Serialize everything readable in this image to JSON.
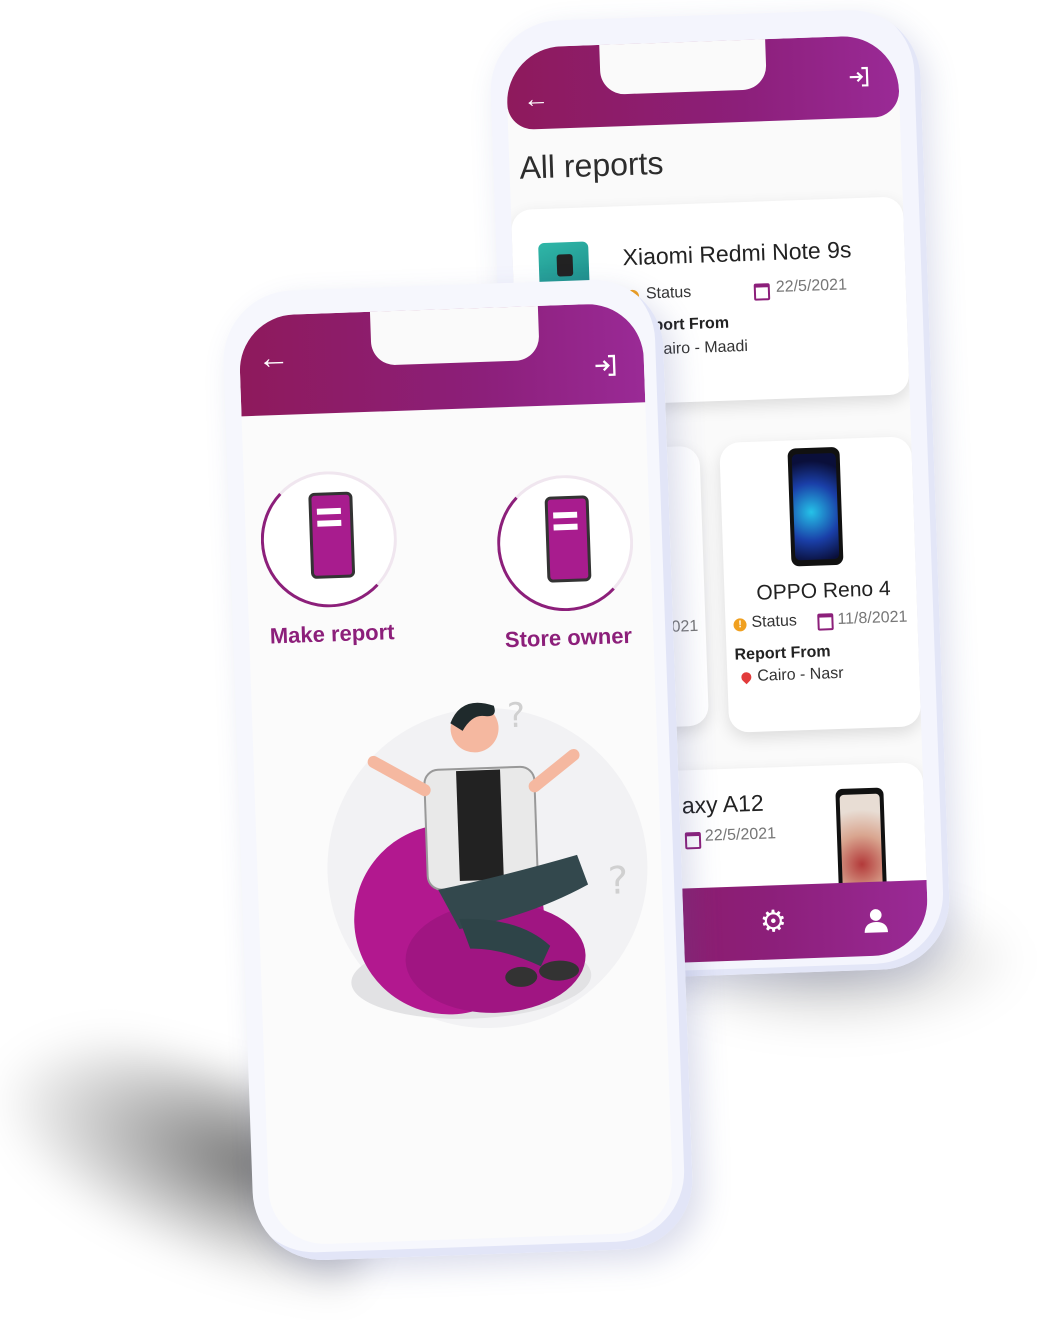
{
  "colors": {
    "primary": "#8c1f7a",
    "status": "#f0a020",
    "pin": "#e23b3b"
  },
  "back_screen": {
    "title": "All reports",
    "header_icons": [
      "back-arrow-icon",
      "logout-icon"
    ],
    "reports": [
      {
        "name": "Xiaomi Redmi Note 9s",
        "status": "Status",
        "date": "22/5/2021",
        "report_from_label": "Report From",
        "location": "Cairo - Maadi"
      },
      {
        "name": "OPPO Reno 4",
        "status": "Status",
        "date": "11/8/2021",
        "report_from_label": "Report From",
        "location": "Cairo - Nasr"
      },
      {
        "name": "axy A12",
        "date": "22/5/2021"
      }
    ],
    "partial_date": "021",
    "bottom_icons": [
      "gear-icon",
      "user-icon"
    ]
  },
  "front_screen": {
    "header_icons": [
      "back-arrow-icon",
      "logout-icon"
    ],
    "options": [
      {
        "label": "Make report",
        "icon": "phone-form-illustration"
      },
      {
        "label": "Store owner",
        "icon": "phone-form-illustration"
      }
    ],
    "illustration": "confused-man-on-beanbag-illustration"
  }
}
